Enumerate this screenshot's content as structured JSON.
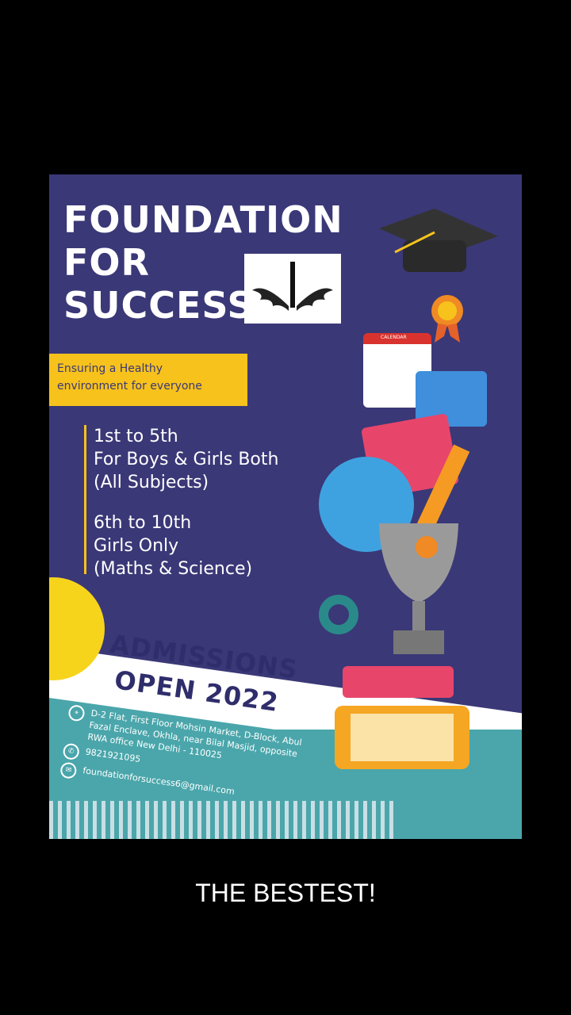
{
  "poster": {
    "title_lines": [
      "FOUNDATION",
      "FOR",
      "SUCCESS"
    ],
    "tagline_lines": [
      "Ensuring a Healthy",
      "environment for everyone"
    ],
    "classes": [
      {
        "grades": "1st to 5th",
        "who": "For Boys & Girls Both",
        "subjects": "(All Subjects)"
      },
      {
        "grades": "6th to 10th",
        "who": "Girls Only",
        "subjects": "(Maths & Science)"
      }
    ],
    "admissions_lines": [
      "ADMISSIONS",
      "OPEN 2022"
    ],
    "address": "D-2 Flat, First Floor Mohsin Market, D-Block, Abul Fazal Enclave, Okhla, near Bilal Masjid, opposite RWA office New Delhi - 110025",
    "phone": "9821921095",
    "email": "foundationforsuccess6@gmail.com",
    "calendar_label": "CALENDAR"
  },
  "caption": "THE BESTEST!",
  "colors": {
    "background": "#3a3877",
    "accent": "#f7c21c",
    "teal": "#4aa6ab"
  }
}
